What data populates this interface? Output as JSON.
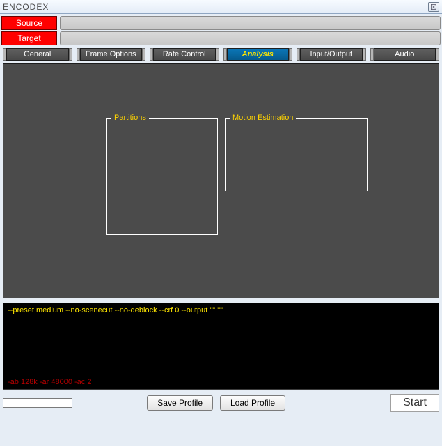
{
  "window": {
    "title": "ENCODEX"
  },
  "paths": {
    "source_label": "Source",
    "source_value": "",
    "target_label": "Target",
    "target_value": ""
  },
  "tabs": {
    "general": "General",
    "frame_options": "Frame Options",
    "rate_control": "Rate Control",
    "analysis": "Analysis",
    "input_output": "Input/Output",
    "audio": "Audio",
    "active": "analysis"
  },
  "analysis": {
    "partitions_label": "Partitions",
    "motion_label": "Motion Estimation"
  },
  "log": {
    "video_cmd": "--preset medium --no-scenecut --no-deblock --crf 0 --output \"\" \"\"",
    "audio_cmd": "-ab 128k -ar 48000 -ac 2"
  },
  "buttons": {
    "save_profile": "Save Profile",
    "load_profile": "Load Profile",
    "start": "Start"
  }
}
